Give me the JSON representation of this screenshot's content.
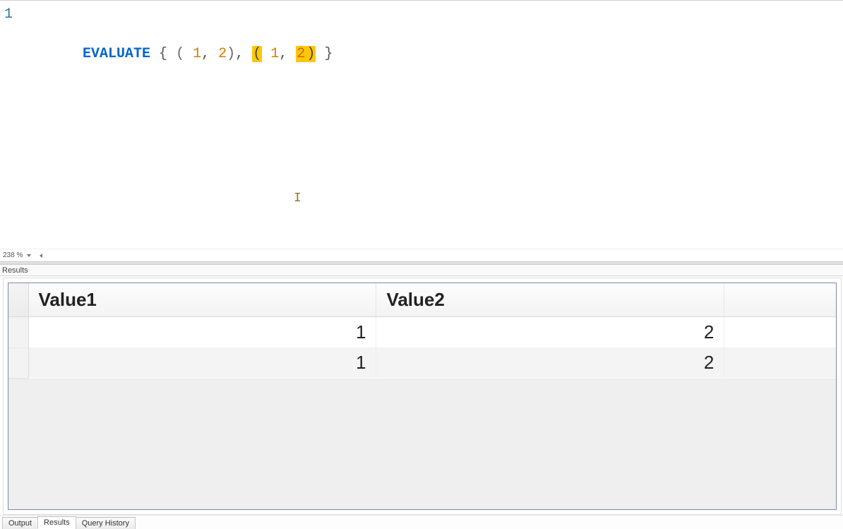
{
  "editor": {
    "line_number": "1",
    "tokens": [
      {
        "t": "EVALUATE",
        "cls": "kw"
      },
      {
        "t": " ",
        "cls": ""
      },
      {
        "t": "{",
        "cls": "pn"
      },
      {
        "t": " ",
        "cls": ""
      },
      {
        "t": "(",
        "cls": "par"
      },
      {
        "t": " ",
        "cls": ""
      },
      {
        "t": "1",
        "cls": "num"
      },
      {
        "t": ",",
        "cls": "pn"
      },
      {
        "t": " ",
        "cls": ""
      },
      {
        "t": "2",
        "cls": "num"
      },
      {
        "t": ")",
        "cls": "par"
      },
      {
        "t": ",",
        "cls": "pn"
      },
      {
        "t": " ",
        "cls": ""
      },
      {
        "t": "(",
        "cls": "par tok-hl"
      },
      {
        "t": " ",
        "cls": ""
      },
      {
        "t": "1",
        "cls": "num"
      },
      {
        "t": ",",
        "cls": "pn"
      },
      {
        "t": " ",
        "cls": ""
      },
      {
        "t": "2",
        "cls": "num tok-hl"
      },
      {
        "t": ")",
        "cls": "par tok-hl"
      },
      {
        "t": " ",
        "cls": ""
      },
      {
        "t": "}",
        "cls": "pn"
      }
    ],
    "caret_glyph": "I",
    "zoom_label": "238 %"
  },
  "results": {
    "panel_label": "Results",
    "columns": [
      "Value1",
      "Value2"
    ],
    "rows": [
      [
        "1",
        "2"
      ],
      [
        "1",
        "2"
      ]
    ]
  },
  "tabs": {
    "items": [
      {
        "label": "Output",
        "active": false
      },
      {
        "label": "Results",
        "active": true
      },
      {
        "label": "Query History",
        "active": false
      }
    ]
  }
}
